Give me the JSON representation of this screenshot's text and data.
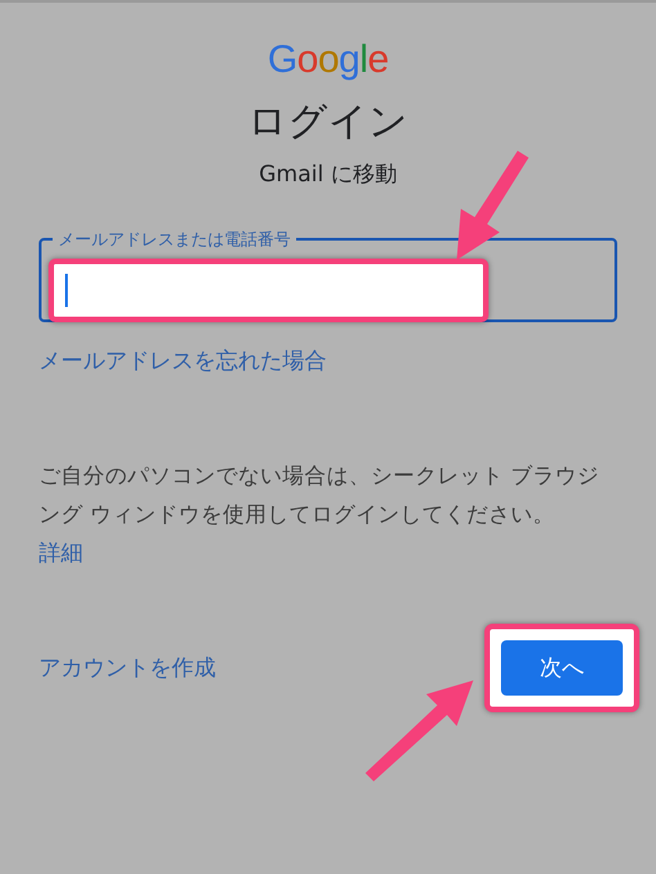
{
  "logo": "Google",
  "title": "ログイン",
  "subtitle": "Gmail に移動",
  "email_field": {
    "label": "メールアドレスまたは電話番号",
    "focused": true
  },
  "forgot_link": "メールアドレスを忘れた場合",
  "notice": "ご自分のパソコンでない場合は、シークレット ブラウジング ウィンドウを使用してログインしてください。",
  "details_link": "詳細",
  "create_account_link": "アカウントを作成",
  "next_button": "次へ"
}
